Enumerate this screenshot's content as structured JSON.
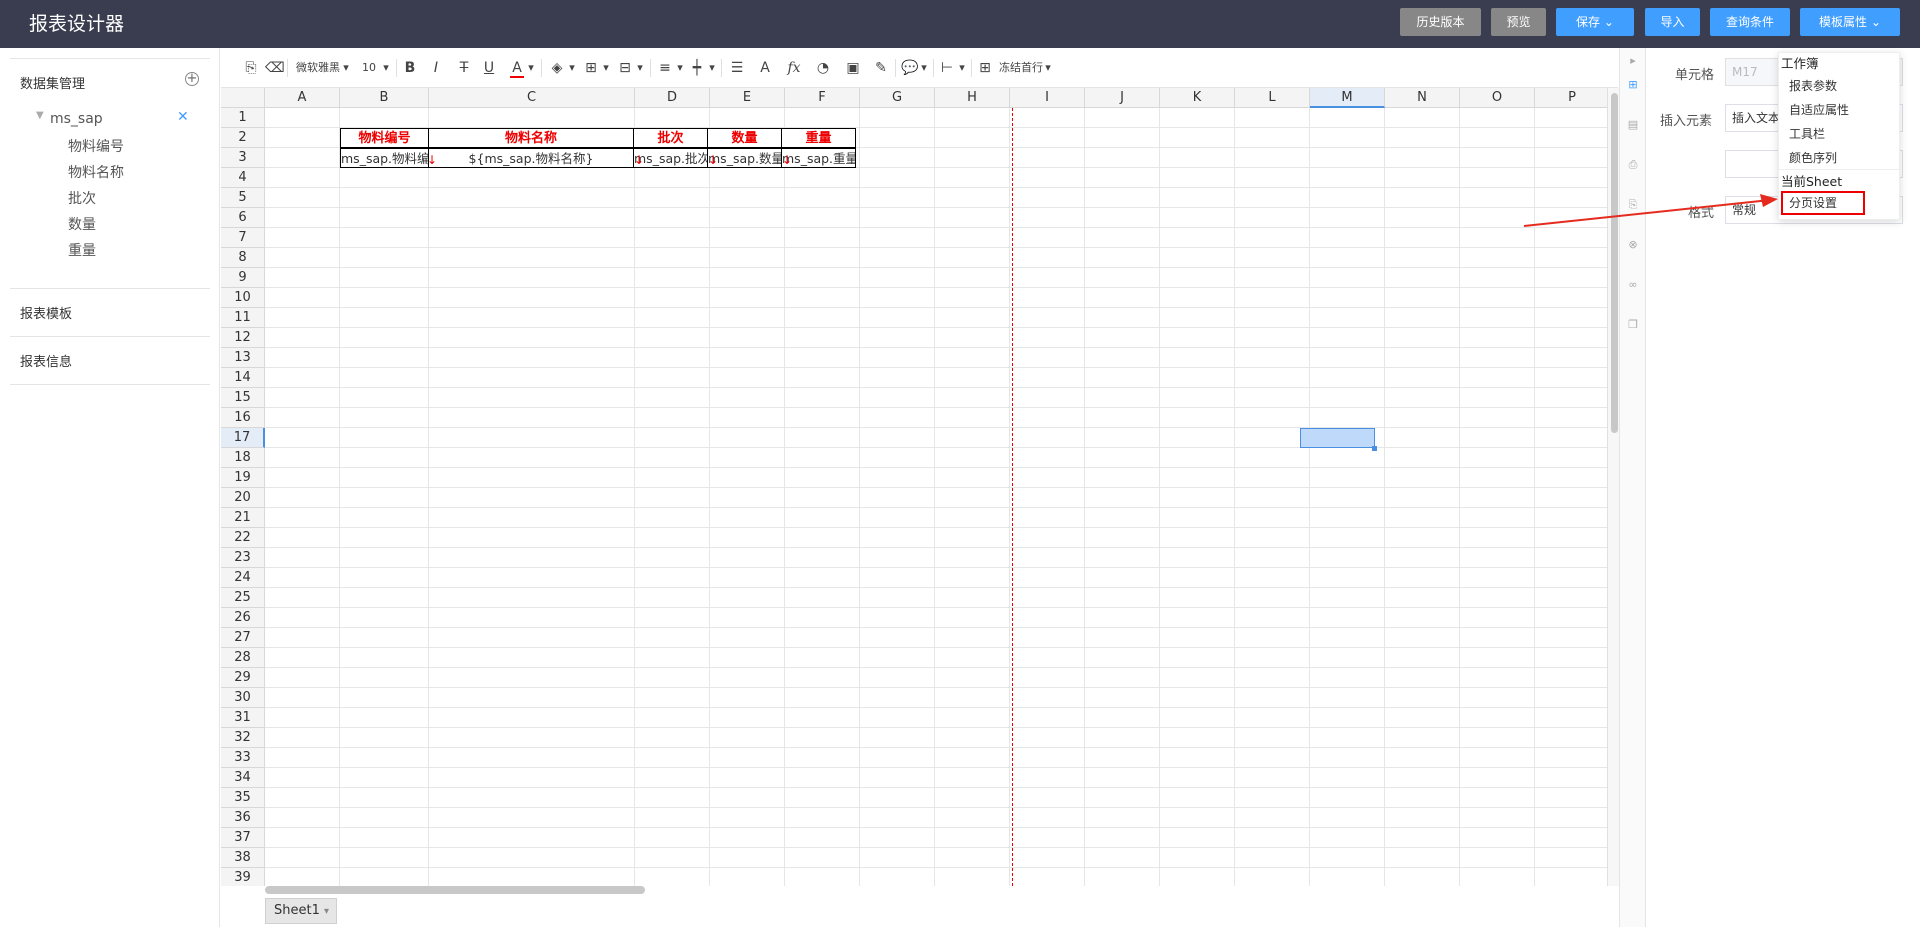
{
  "header": {
    "title": "报表设计器",
    "buttons": {
      "history": "历史版本",
      "preview": "预览",
      "save": "保存",
      "import": "导入",
      "query": "查询条件",
      "template_props": "模板属性"
    }
  },
  "left_panel": {
    "dataset_mgmt": "数据集管理",
    "dataset_name": "ms_sap",
    "fields": [
      "物料编号",
      "物料名称",
      "批次",
      "数量",
      "重量"
    ],
    "report_template": "报表模板",
    "report_info": "报表信息"
  },
  "toolbar": {
    "font": "微软雅黑",
    "size": "10",
    "freeze": "冻结首行",
    "bold": "B",
    "italic": "I",
    "strike": "T",
    "underline": "U",
    "fontcolor": "A",
    "font_a": "A",
    "fx": "fx"
  },
  "grid": {
    "columns": [
      "A",
      "B",
      "C",
      "D",
      "E",
      "F",
      "G",
      "H",
      "I",
      "J",
      "K",
      "L",
      "M",
      "N",
      "O",
      "P"
    ],
    "rows": [
      "1",
      "2",
      "3",
      "4",
      "5",
      "6",
      "7",
      "8",
      "9",
      "10",
      "11",
      "12",
      "13",
      "14",
      "15",
      "16",
      "17",
      "18",
      "19",
      "20",
      "21",
      "22",
      "23",
      "24",
      "25",
      "26",
      "27",
      "28",
      "29",
      "30",
      "31",
      "32",
      "33",
      "34",
      "35",
      "36",
      "37",
      "38",
      "39"
    ],
    "headers": [
      "物料编号",
      "物料名称",
      "批次",
      "数量",
      "重量"
    ],
    "values": [
      "ms_sap.物料编",
      "${ms_sap.物料名称}",
      "ms_sap.批次",
      "ms_sap.数量",
      "ms_sap.重量"
    ],
    "selected_cell": "M17"
  },
  "right_panel": {
    "cell_label": "单元格",
    "cell_value": "M17",
    "insert_label": "插入元素",
    "insert_value": "插入文本",
    "format_label": "格式",
    "format_value": "常规"
  },
  "dropdown": {
    "group1": "工作簿",
    "items1": [
      "报表参数",
      "自适应属性",
      "工具栏",
      "颜色序列"
    ],
    "group2": "当前Sheet",
    "items2": [
      "分页设置"
    ]
  },
  "sheet_tab": "Sheet1",
  "colors": {
    "header_bg": "#393d4f",
    "primary": "#409eff",
    "gray_btn": "#878787",
    "highlight": "#e00"
  }
}
